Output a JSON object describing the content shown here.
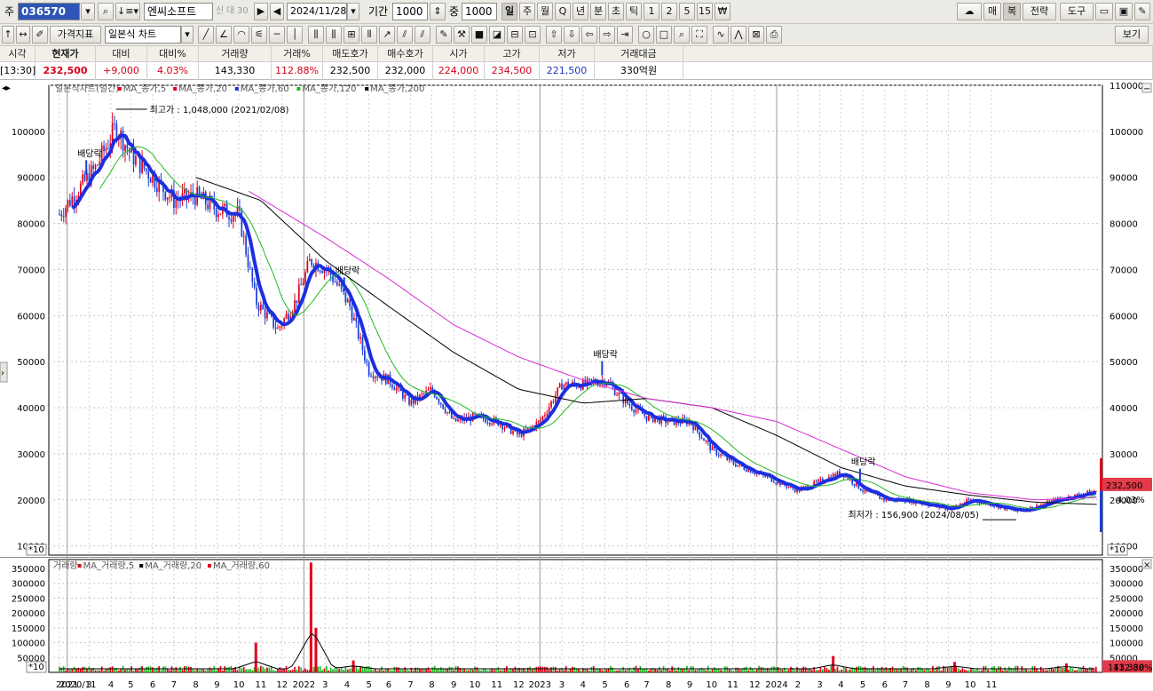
{
  "toolbar": {
    "prefix_label": "주",
    "code": "036570",
    "stock_name": "엔씨소프트",
    "badge1": "신",
    "badge2": "대",
    "badge3": "30",
    "date": "2024/11/28",
    "period_label": "기간",
    "period_value": "1000",
    "weight_label": "중",
    "weight_value": "1000",
    "intervals": [
      "일",
      "주",
      "월",
      "Q",
      "년",
      "분",
      "초",
      "틱",
      "1",
      "2",
      "5",
      "15",
      "₩"
    ],
    "right_buttons": [
      "매",
      "복",
      "전략",
      "도구"
    ]
  },
  "toolbar2": {
    "price_indicator": "가격지표",
    "chart_type": "일본식 차트",
    "view_button": "보기"
  },
  "quote": {
    "headers": [
      "시각",
      "현재가",
      "대비",
      "대비%",
      "거래량",
      "거래%",
      "매도호가",
      "매수호가",
      "시가",
      "고가",
      "저가",
      "거래대금"
    ],
    "values": [
      "[13:30]",
      "232,500",
      "+9,000",
      "4.03%",
      "143,330",
      "112.88%",
      "232,500",
      "232,000",
      "224,000",
      "234,500",
      "221,500",
      "330억원"
    ]
  },
  "legend": {
    "price": [
      "일본식차트(일간)",
      "MA_종가,5",
      "MA_종가,20",
      "MA_종가,60",
      "MA_종가,120",
      "MA_종가,200"
    ],
    "volume": [
      "거래량",
      "MA_거래량,5",
      "MA_거래량,20",
      "MA_거래량,60"
    ]
  },
  "colors": {
    "up": "#e0001b",
    "down": "#1a3fd6",
    "ma5": "#e0001b",
    "ma20": "#1c2fe0",
    "ma60": "#1c2fe0",
    "ma120": "#23b823",
    "ma200": "#000000",
    "ma_long": "#d82ad8",
    "volume_up": "#e0001b",
    "volume_ma": "#23b823"
  },
  "annotations": {
    "high": "최고가 : 1,048,000 (2021/02/08)",
    "low": "최저가 : 156,900 (2024/08/05)",
    "dividend": "배당락",
    "price_tag": "232,500",
    "change_tag": "4.03%",
    "volume_tag": "143,330",
    "volume_pct_tag": "112.88%",
    "multiplier": "*10"
  },
  "chart_data": {
    "type": "candlestick",
    "title": "",
    "xlabel": "",
    "ylabel": "",
    "price_axis": {
      "ticks": [
        10000,
        20000,
        30000,
        40000,
        50000,
        60000,
        70000,
        80000,
        90000,
        100000
      ],
      "right_ticks": [
        10000,
        20000,
        30000,
        40000,
        50000,
        60000,
        70000,
        80000,
        90000,
        100000,
        110000
      ],
      "ylim": [
        8000,
        110000
      ],
      "scale_note": "*10"
    },
    "volume_axis": {
      "ticks": [
        50000,
        100000,
        150000,
        200000,
        250000,
        300000,
        350000
      ],
      "ylim": [
        0,
        380000
      ]
    },
    "x_ticks": [
      "2020/11",
      "2021",
      "3",
      "4",
      "5",
      "6",
      "7",
      "8",
      "9",
      "10",
      "11",
      "12",
      "2022",
      "3",
      "4",
      "5",
      "6",
      "7",
      "8",
      "9",
      "10",
      "11",
      "12",
      "2023",
      "3",
      "4",
      "5",
      "6",
      "7",
      "8",
      "9",
      "10",
      "11",
      "12",
      "2024",
      "2",
      "3",
      "4",
      "5",
      "6",
      "7",
      "8",
      "9",
      "10",
      "11"
    ],
    "price_path": [
      [
        "2020-11-20",
        82000
      ],
      [
        "2020-12-10",
        86000
      ],
      [
        "2021-01-10",
        92000
      ],
      [
        "2021-02-08",
        101000
      ],
      [
        "2021-03-01",
        95000
      ],
      [
        "2021-04-01",
        90000
      ],
      [
        "2021-05-01",
        85000
      ],
      [
        "2021-06-01",
        86000
      ],
      [
        "2021-07-01",
        83000
      ],
      [
        "2021-08-01",
        82000
      ],
      [
        "2021-08-25",
        63000
      ],
      [
        "2021-09-25",
        57000
      ],
      [
        "2021-10-20",
        63000
      ],
      [
        "2021-11-10",
        72000
      ],
      [
        "2021-12-05",
        70000
      ],
      [
        "2022-01-05",
        62000
      ],
      [
        "2022-02-01",
        48000
      ],
      [
        "2022-03-01",
        46000
      ],
      [
        "2022-04-01",
        41000
      ],
      [
        "2022-05-01",
        44000
      ],
      [
        "2022-06-01",
        37000
      ],
      [
        "2022-07-01",
        38000
      ],
      [
        "2022-08-01",
        37000
      ],
      [
        "2022-09-01",
        34000
      ],
      [
        "2022-10-01",
        37000
      ],
      [
        "2022-11-01",
        45000
      ],
      [
        "2022-12-01",
        45000
      ],
      [
        "2023-01-01",
        46000
      ],
      [
        "2023-02-01",
        41000
      ],
      [
        "2023-03-01",
        38000
      ],
      [
        "2023-04-01",
        37000
      ],
      [
        "2023-05-01",
        37000
      ],
      [
        "2023-06-01",
        31000
      ],
      [
        "2023-07-01",
        28000
      ],
      [
        "2023-08-01",
        26000
      ],
      [
        "2023-09-01",
        24000
      ],
      [
        "2023-10-01",
        22000
      ],
      [
        "2023-11-01",
        24000
      ],
      [
        "2023-12-01",
        26000
      ],
      [
        "2024-01-01",
        22000
      ],
      [
        "2024-02-01",
        20000
      ],
      [
        "2024-03-01",
        20000
      ],
      [
        "2024-04-01",
        19000
      ],
      [
        "2024-05-01",
        18000
      ],
      [
        "2024-06-01",
        20000
      ],
      [
        "2024-07-01",
        19000
      ],
      [
        "2024-08-05",
        17500
      ],
      [
        "2024-09-01",
        18500
      ],
      [
        "2024-10-01",
        20000
      ],
      [
        "2024-11-28",
        22000
      ]
    ],
    "ma200_path": [
      [
        "2021-06-01",
        90000
      ],
      [
        "2021-09-01",
        85000
      ],
      [
        "2021-12-01",
        72000
      ],
      [
        "2022-03-01",
        62000
      ],
      [
        "2022-06-01",
        52000
      ],
      [
        "2022-09-01",
        44000
      ],
      [
        "2022-12-01",
        41000
      ],
      [
        "2023-03-01",
        42000
      ],
      [
        "2023-06-01",
        40000
      ],
      [
        "2023-09-01",
        34000
      ],
      [
        "2023-12-01",
        27000
      ],
      [
        "2024-03-01",
        23000
      ],
      [
        "2024-06-01",
        21000
      ],
      [
        "2024-09-01",
        19500
      ],
      [
        "2024-11-28",
        19000
      ]
    ],
    "ma_long_path": [
      [
        "2021-08-15",
        87000
      ],
      [
        "2021-12-01",
        77000
      ],
      [
        "2022-03-01",
        68000
      ],
      [
        "2022-06-01",
        58000
      ],
      [
        "2022-09-01",
        51000
      ],
      [
        "2022-12-01",
        46000
      ],
      [
        "2023-03-01",
        42000
      ],
      [
        "2023-06-01",
        40000
      ],
      [
        "2023-09-01",
        37000
      ],
      [
        "2023-12-01",
        31000
      ],
      [
        "2024-03-01",
        25000
      ],
      [
        "2024-06-01",
        21500
      ],
      [
        "2024-09-01",
        20000
      ],
      [
        "2024-11-28",
        20500
      ]
    ],
    "volume_spikes": [
      [
        "2021-08-25",
        100000
      ],
      [
        "2021-11-11",
        370000
      ],
      [
        "2021-11-18",
        150000
      ],
      [
        "2022-01-10",
        40000
      ],
      [
        "2023-11-20",
        55000
      ],
      [
        "2024-05-10",
        35000
      ],
      [
        "2024-10-15",
        30000
      ]
    ],
    "dividend_markers": [
      "2020-12-28",
      "2021-12-28",
      "2022-12-28",
      "2023-12-28"
    ],
    "last_price": 232500,
    "change_pct": 4.03
  }
}
